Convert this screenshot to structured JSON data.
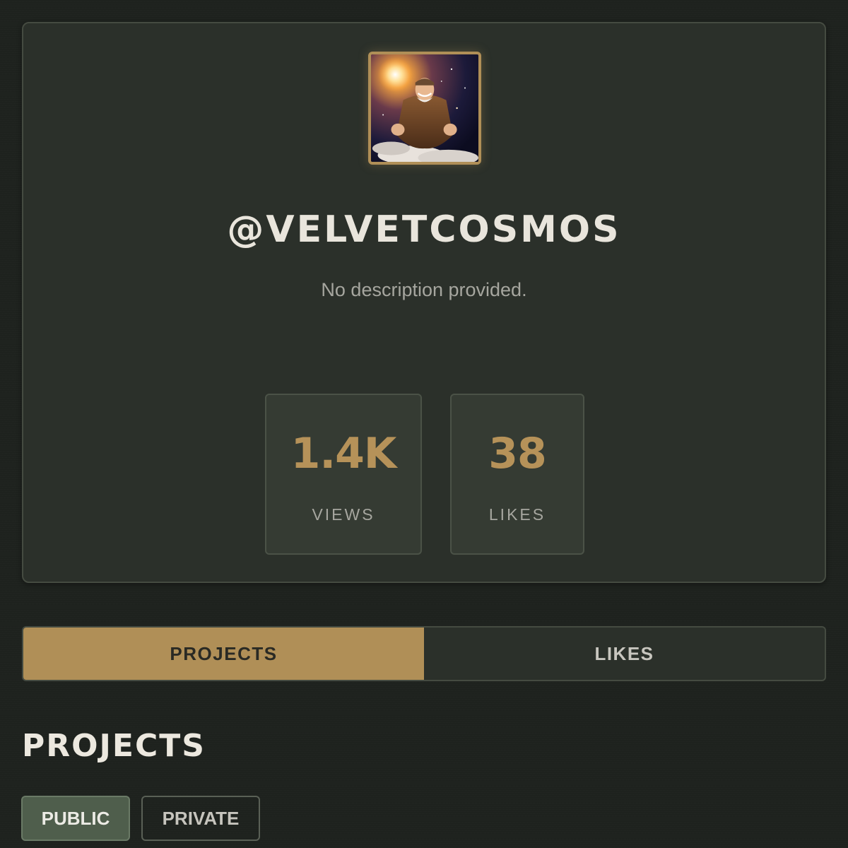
{
  "profile": {
    "avatar_alt": "smiling elderly man in fur coat flying above clouds in space",
    "username": "@VELVETCOSMOS",
    "description": "No description provided."
  },
  "stats": [
    {
      "value": "1.4K",
      "label": "VIEWS"
    },
    {
      "value": "38",
      "label": "LIKES"
    }
  ],
  "tabs": [
    {
      "label": "PROJECTS",
      "active": true
    },
    {
      "label": "LIKES",
      "active": false
    }
  ],
  "section": {
    "title": "PROJECTS"
  },
  "filters": [
    {
      "label": "PUBLIC",
      "active": true
    },
    {
      "label": "PRIVATE",
      "active": false
    }
  ],
  "colors": {
    "accent": "#b08f57",
    "background": "#1e221e",
    "card": "#2b302a"
  }
}
